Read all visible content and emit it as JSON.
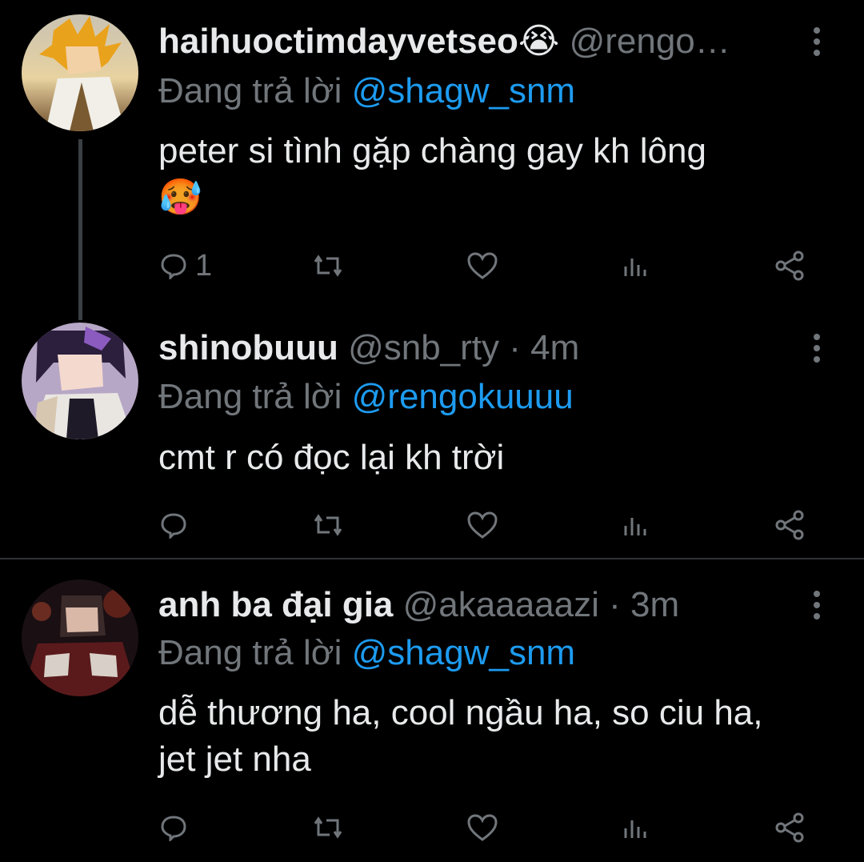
{
  "colors": {
    "background": "#000000",
    "text": "#e7e9ea",
    "secondary": "#71767b",
    "link": "#1d9bf0",
    "divider": "#2f3336"
  },
  "replying_label": "Đang trả lời",
  "tweets": [
    {
      "display_name": "haihuoctimdayvetseo",
      "name_emoji": "😭",
      "handle": "@rengo…",
      "time": "",
      "reply_to": "@shagw_snm",
      "text": "peter si tình gặp chàng gay kh lông",
      "text_emoji": "🥵",
      "reply_count": "1",
      "avatar": "avatar-flame-hair-character"
    },
    {
      "display_name": "shinobuuu",
      "handle": "@snb_rty",
      "time": "· 4m",
      "reply_to": "@rengokuuuu",
      "text": "cmt r có đọc lại kh trời",
      "reply_count": "",
      "avatar": "avatar-purple-hair-character"
    },
    {
      "display_name": "anh ba đại gia",
      "handle": "@akaaaaazi",
      "time": "· 3m",
      "reply_to": "@shagw_snm",
      "text": "dễ thương ha, cool ngầu ha, so ciu ha, jet jet nha",
      "reply_count": "",
      "avatar": "avatar-dark-red-character"
    }
  ],
  "icons": [
    "reply-icon",
    "retweet-icon",
    "like-icon",
    "views-icon",
    "share-icon",
    "more-options-icon"
  ]
}
